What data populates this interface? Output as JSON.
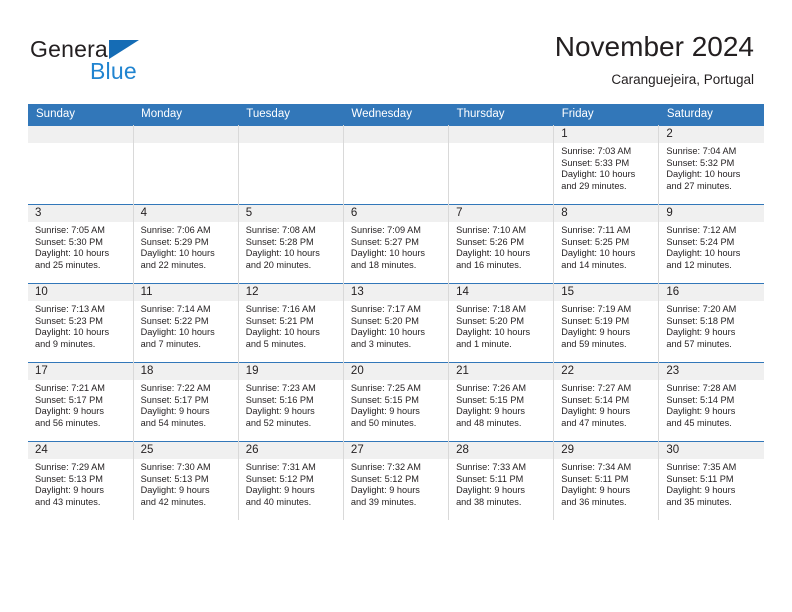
{
  "brand": {
    "name_part1": "General",
    "name_part2": "Blue",
    "triangle_color": "#156cb5",
    "blue_color": "#2084d0"
  },
  "header": {
    "title": "November 2024",
    "subtitle": "Caranguejeira, Portugal",
    "accent_color": "#3277b9"
  },
  "weekdays": [
    "Sunday",
    "Monday",
    "Tuesday",
    "Wednesday",
    "Thursday",
    "Friday",
    "Saturday"
  ],
  "labels": {
    "sunrise_prefix": "Sunrise: ",
    "sunset_prefix": "Sunset: ",
    "daylight_prefix": "Daylight: "
  },
  "weeks": [
    [
      {
        "date": "",
        "empty": true
      },
      {
        "date": "",
        "empty": true
      },
      {
        "date": "",
        "empty": true
      },
      {
        "date": "",
        "empty": true
      },
      {
        "date": "",
        "empty": true
      },
      {
        "date": "1",
        "sunrise": "Sunrise: 7:03 AM",
        "sunset": "Sunset: 5:33 PM",
        "daylight_line1": "Daylight: 10 hours",
        "daylight_line2": "and 29 minutes."
      },
      {
        "date": "2",
        "sunrise": "Sunrise: 7:04 AM",
        "sunset": "Sunset: 5:32 PM",
        "daylight_line1": "Daylight: 10 hours",
        "daylight_line2": "and 27 minutes."
      }
    ],
    [
      {
        "date": "3",
        "sunrise": "Sunrise: 7:05 AM",
        "sunset": "Sunset: 5:30 PM",
        "daylight_line1": "Daylight: 10 hours",
        "daylight_line2": "and 25 minutes."
      },
      {
        "date": "4",
        "sunrise": "Sunrise: 7:06 AM",
        "sunset": "Sunset: 5:29 PM",
        "daylight_line1": "Daylight: 10 hours",
        "daylight_line2": "and 22 minutes."
      },
      {
        "date": "5",
        "sunrise": "Sunrise: 7:08 AM",
        "sunset": "Sunset: 5:28 PM",
        "daylight_line1": "Daylight: 10 hours",
        "daylight_line2": "and 20 minutes."
      },
      {
        "date": "6",
        "sunrise": "Sunrise: 7:09 AM",
        "sunset": "Sunset: 5:27 PM",
        "daylight_line1": "Daylight: 10 hours",
        "daylight_line2": "and 18 minutes."
      },
      {
        "date": "7",
        "sunrise": "Sunrise: 7:10 AM",
        "sunset": "Sunset: 5:26 PM",
        "daylight_line1": "Daylight: 10 hours",
        "daylight_line2": "and 16 minutes."
      },
      {
        "date": "8",
        "sunrise": "Sunrise: 7:11 AM",
        "sunset": "Sunset: 5:25 PM",
        "daylight_line1": "Daylight: 10 hours",
        "daylight_line2": "and 14 minutes."
      },
      {
        "date": "9",
        "sunrise": "Sunrise: 7:12 AM",
        "sunset": "Sunset: 5:24 PM",
        "daylight_line1": "Daylight: 10 hours",
        "daylight_line2": "and 12 minutes."
      }
    ],
    [
      {
        "date": "10",
        "sunrise": "Sunrise: 7:13 AM",
        "sunset": "Sunset: 5:23 PM",
        "daylight_line1": "Daylight: 10 hours",
        "daylight_line2": "and 9 minutes."
      },
      {
        "date": "11",
        "sunrise": "Sunrise: 7:14 AM",
        "sunset": "Sunset: 5:22 PM",
        "daylight_line1": "Daylight: 10 hours",
        "daylight_line2": "and 7 minutes."
      },
      {
        "date": "12",
        "sunrise": "Sunrise: 7:16 AM",
        "sunset": "Sunset: 5:21 PM",
        "daylight_line1": "Daylight: 10 hours",
        "daylight_line2": "and 5 minutes."
      },
      {
        "date": "13",
        "sunrise": "Sunrise: 7:17 AM",
        "sunset": "Sunset: 5:20 PM",
        "daylight_line1": "Daylight: 10 hours",
        "daylight_line2": "and 3 minutes."
      },
      {
        "date": "14",
        "sunrise": "Sunrise: 7:18 AM",
        "sunset": "Sunset: 5:20 PM",
        "daylight_line1": "Daylight: 10 hours",
        "daylight_line2": "and 1 minute."
      },
      {
        "date": "15",
        "sunrise": "Sunrise: 7:19 AM",
        "sunset": "Sunset: 5:19 PM",
        "daylight_line1": "Daylight: 9 hours",
        "daylight_line2": "and 59 minutes."
      },
      {
        "date": "16",
        "sunrise": "Sunrise: 7:20 AM",
        "sunset": "Sunset: 5:18 PM",
        "daylight_line1": "Daylight: 9 hours",
        "daylight_line2": "and 57 minutes."
      }
    ],
    [
      {
        "date": "17",
        "sunrise": "Sunrise: 7:21 AM",
        "sunset": "Sunset: 5:17 PM",
        "daylight_line1": "Daylight: 9 hours",
        "daylight_line2": "and 56 minutes."
      },
      {
        "date": "18",
        "sunrise": "Sunrise: 7:22 AM",
        "sunset": "Sunset: 5:17 PM",
        "daylight_line1": "Daylight: 9 hours",
        "daylight_line2": "and 54 minutes."
      },
      {
        "date": "19",
        "sunrise": "Sunrise: 7:23 AM",
        "sunset": "Sunset: 5:16 PM",
        "daylight_line1": "Daylight: 9 hours",
        "daylight_line2": "and 52 minutes."
      },
      {
        "date": "20",
        "sunrise": "Sunrise: 7:25 AM",
        "sunset": "Sunset: 5:15 PM",
        "daylight_line1": "Daylight: 9 hours",
        "daylight_line2": "and 50 minutes."
      },
      {
        "date": "21",
        "sunrise": "Sunrise: 7:26 AM",
        "sunset": "Sunset: 5:15 PM",
        "daylight_line1": "Daylight: 9 hours",
        "daylight_line2": "and 48 minutes."
      },
      {
        "date": "22",
        "sunrise": "Sunrise: 7:27 AM",
        "sunset": "Sunset: 5:14 PM",
        "daylight_line1": "Daylight: 9 hours",
        "daylight_line2": "and 47 minutes."
      },
      {
        "date": "23",
        "sunrise": "Sunrise: 7:28 AM",
        "sunset": "Sunset: 5:14 PM",
        "daylight_line1": "Daylight: 9 hours",
        "daylight_line2": "and 45 minutes."
      }
    ],
    [
      {
        "date": "24",
        "sunrise": "Sunrise: 7:29 AM",
        "sunset": "Sunset: 5:13 PM",
        "daylight_line1": "Daylight: 9 hours",
        "daylight_line2": "and 43 minutes."
      },
      {
        "date": "25",
        "sunrise": "Sunrise: 7:30 AM",
        "sunset": "Sunset: 5:13 PM",
        "daylight_line1": "Daylight: 9 hours",
        "daylight_line2": "and 42 minutes."
      },
      {
        "date": "26",
        "sunrise": "Sunrise: 7:31 AM",
        "sunset": "Sunset: 5:12 PM",
        "daylight_line1": "Daylight: 9 hours",
        "daylight_line2": "and 40 minutes."
      },
      {
        "date": "27",
        "sunrise": "Sunrise: 7:32 AM",
        "sunset": "Sunset: 5:12 PM",
        "daylight_line1": "Daylight: 9 hours",
        "daylight_line2": "and 39 minutes."
      },
      {
        "date": "28",
        "sunrise": "Sunrise: 7:33 AM",
        "sunset": "Sunset: 5:11 PM",
        "daylight_line1": "Daylight: 9 hours",
        "daylight_line2": "and 38 minutes."
      },
      {
        "date": "29",
        "sunrise": "Sunrise: 7:34 AM",
        "sunset": "Sunset: 5:11 PM",
        "daylight_line1": "Daylight: 9 hours",
        "daylight_line2": "and 36 minutes."
      },
      {
        "date": "30",
        "sunrise": "Sunrise: 7:35 AM",
        "sunset": "Sunset: 5:11 PM",
        "daylight_line1": "Daylight: 9 hours",
        "daylight_line2": "and 35 minutes."
      }
    ]
  ]
}
